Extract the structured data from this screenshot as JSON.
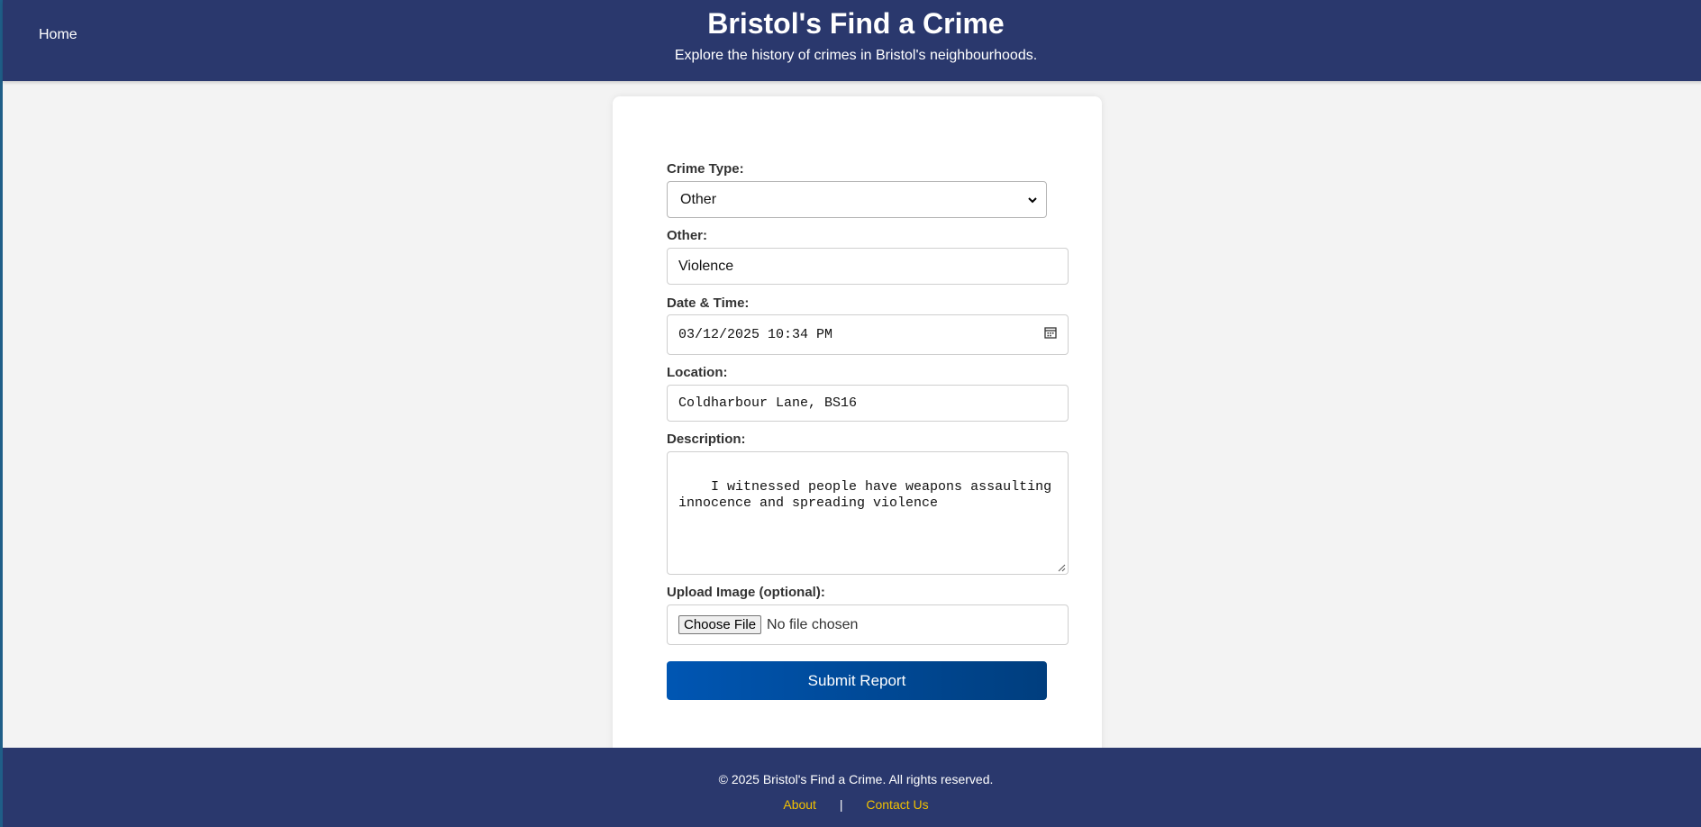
{
  "header": {
    "nav_home": "Home",
    "title": "Bristol's Find a Crime",
    "subtitle": "Explore the history of crimes in Bristol's neighbourhoods."
  },
  "form": {
    "crime_type_label": "Crime Type:",
    "crime_type_value": "Other",
    "other_label": "Other:",
    "other_value": "Violence",
    "datetime_label": "Date & Time:",
    "datetime_value": "03/12/2025 10:34 PM",
    "location_label": "Location:",
    "location_value": "Coldharbour Lane, BS16",
    "description_label": "Description:",
    "description_value": "I witnessed people have weapons assaulting\ninnocence and spreading violence",
    "upload_label": "Upload Image (optional):",
    "choose_file": "Choose File",
    "no_file": "No file chosen",
    "submit_label": "Submit Report"
  },
  "footer": {
    "copyright": "© 2025 Bristol's Find a Crime. All rights reserved.",
    "about": "About",
    "separator": "|",
    "contact": "Contact Us"
  },
  "colors": {
    "header_bg": "#2a386d",
    "submit_gradient_start": "#0056b3",
    "submit_gradient_end": "#003e7e",
    "footer_link": "#f0c000"
  },
  "icons": {
    "datetime_icon": "calendar-icon",
    "select_icon": "chevron-down-icon"
  }
}
